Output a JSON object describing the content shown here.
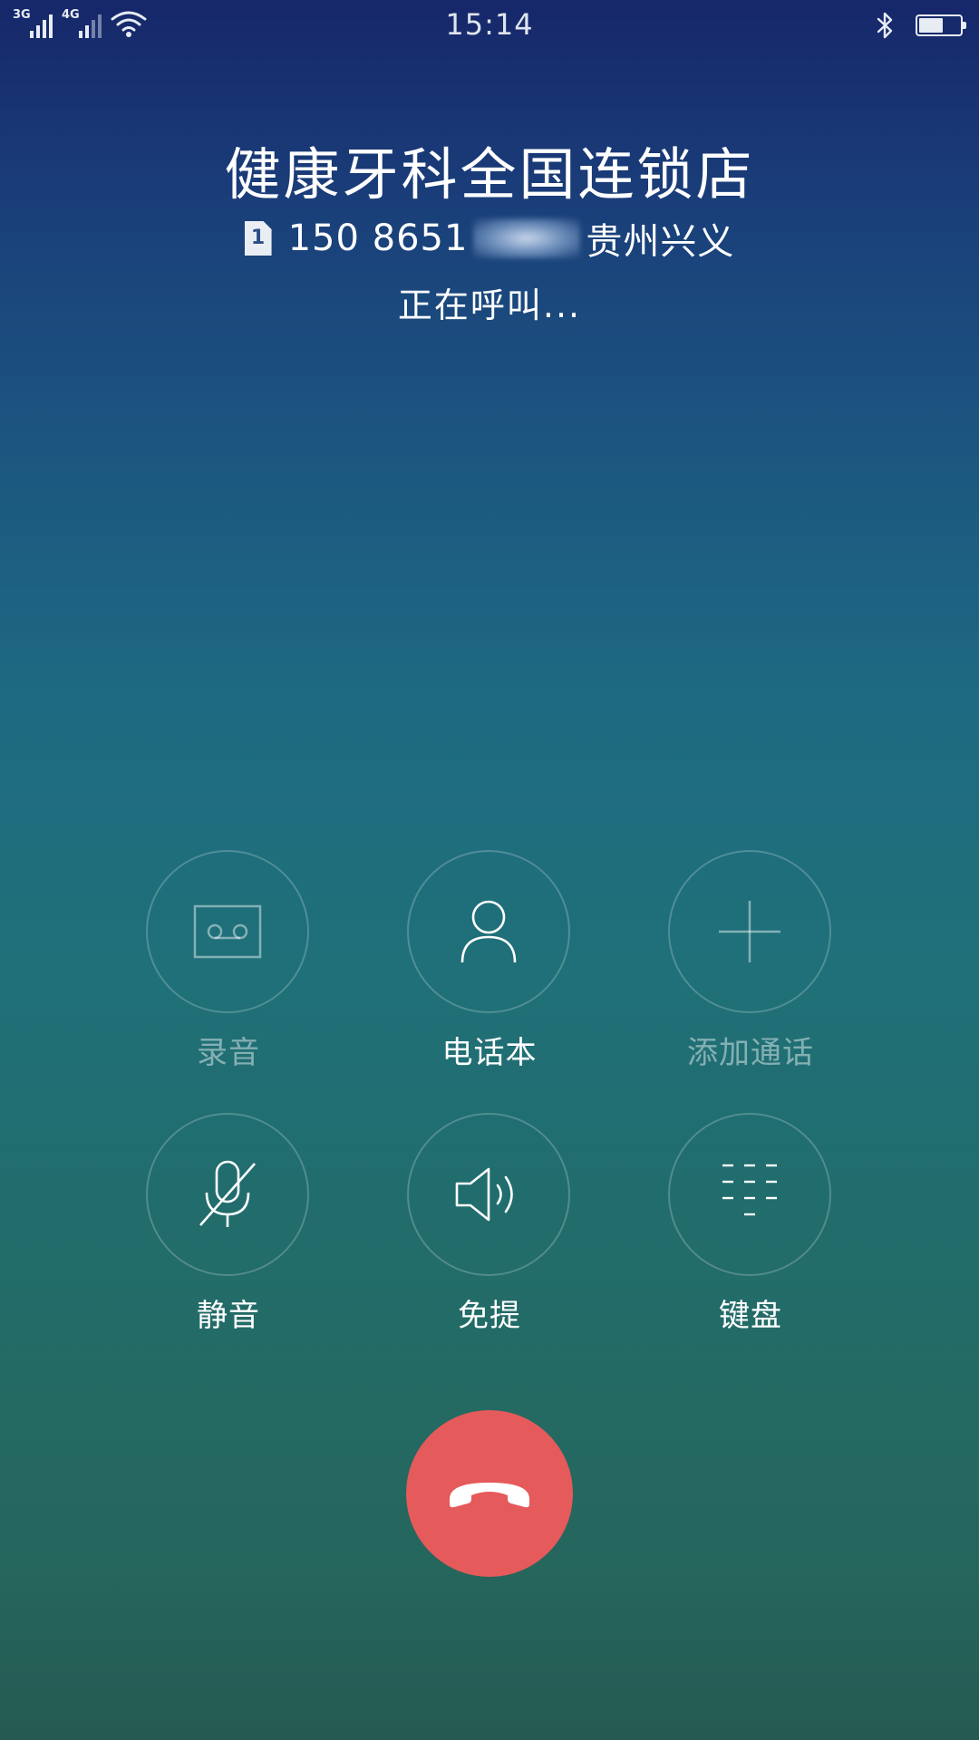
{
  "status_bar": {
    "network_1": "3G",
    "network_2": "4G",
    "time": "15:14",
    "battery_level": 0.6
  },
  "caller": {
    "name": "健康牙科全国连锁店",
    "sim_slot": "1",
    "number_visible": "150 8651",
    "location_visible": "贵州兴义",
    "status": "正在呼叫..."
  },
  "actions": {
    "record": {
      "label": "录音",
      "icon": "cassette-icon",
      "enabled": false
    },
    "contacts": {
      "label": "电话本",
      "icon": "person-icon",
      "enabled": true
    },
    "add_call": {
      "label": "添加通话",
      "icon": "plus-icon",
      "enabled": false
    },
    "mute": {
      "label": "静音",
      "icon": "mic-muted-icon",
      "enabled": true
    },
    "speaker": {
      "label": "免提",
      "icon": "speaker-icon",
      "enabled": true
    },
    "keypad": {
      "label": "键盘",
      "icon": "dialpad-icon",
      "enabled": true
    }
  },
  "end_call": {
    "icon": "hang-up-icon",
    "color": "#e55a5a"
  },
  "colors": {
    "background_top": "#16276a",
    "background_bottom": "#255a52",
    "disabled_label": "rgba(255,255,255,0.45)"
  }
}
